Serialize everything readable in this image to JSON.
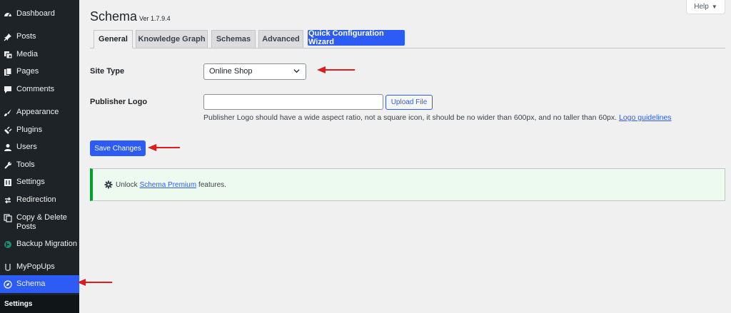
{
  "sidebar": {
    "items": [
      {
        "label": "Dashboard",
        "icon": "dashboard-icon"
      },
      {
        "label": "Posts",
        "icon": "pin-icon"
      },
      {
        "label": "Media",
        "icon": "media-icon"
      },
      {
        "label": "Pages",
        "icon": "pages-icon"
      },
      {
        "label": "Comments",
        "icon": "comment-icon"
      },
      {
        "label": "Appearance",
        "icon": "brush-icon"
      },
      {
        "label": "Plugins",
        "icon": "plug-icon"
      },
      {
        "label": "Users",
        "icon": "user-icon"
      },
      {
        "label": "Tools",
        "icon": "wrench-icon"
      },
      {
        "label": "Settings",
        "icon": "settings-icon"
      },
      {
        "label": "Redirection",
        "icon": "redirect-icon"
      },
      {
        "label": "Copy & Delete Posts",
        "label_line1": "Copy & Delete",
        "label_line2": "Posts",
        "icon": "copy-icon"
      },
      {
        "label": "Backup Migration",
        "icon": "backup-icon"
      },
      {
        "label": "MyPopUps",
        "icon": "popup-icon"
      },
      {
        "label": "Schema",
        "icon": "compass-icon",
        "active": true
      }
    ],
    "submenu_label": "Settings"
  },
  "help": {
    "label": "Help",
    "arrow": "▼"
  },
  "page": {
    "title": "Schema",
    "version": "Ver 1.7.9.4"
  },
  "tabs": [
    {
      "label": "General",
      "active": true
    },
    {
      "label": "Knowledge Graph"
    },
    {
      "label": "Schemas"
    },
    {
      "label": "Advanced"
    },
    {
      "label": "Quick Configuration Wizard",
      "style": "primary"
    }
  ],
  "form": {
    "site_type": {
      "label": "Site Type",
      "value": "Online Shop"
    },
    "publisher_logo": {
      "label": "Publisher Logo",
      "value": "",
      "upload_label": "Upload File",
      "help_text": "Publisher Logo should have a wide aspect ratio, not a square icon, it should be no wider than 600px, and no taller than 60px.",
      "help_link": "Logo guidelines"
    },
    "save_label": "Save Changes"
  },
  "notice": {
    "prefix": "Unlock",
    "link": "Schema Premium",
    "suffix": "features."
  },
  "colors": {
    "sidebar_bg": "#1d2327",
    "accent": "#2c5cf5",
    "notice_border": "#00a32a",
    "annotation_arrow": "#e01b1b"
  }
}
